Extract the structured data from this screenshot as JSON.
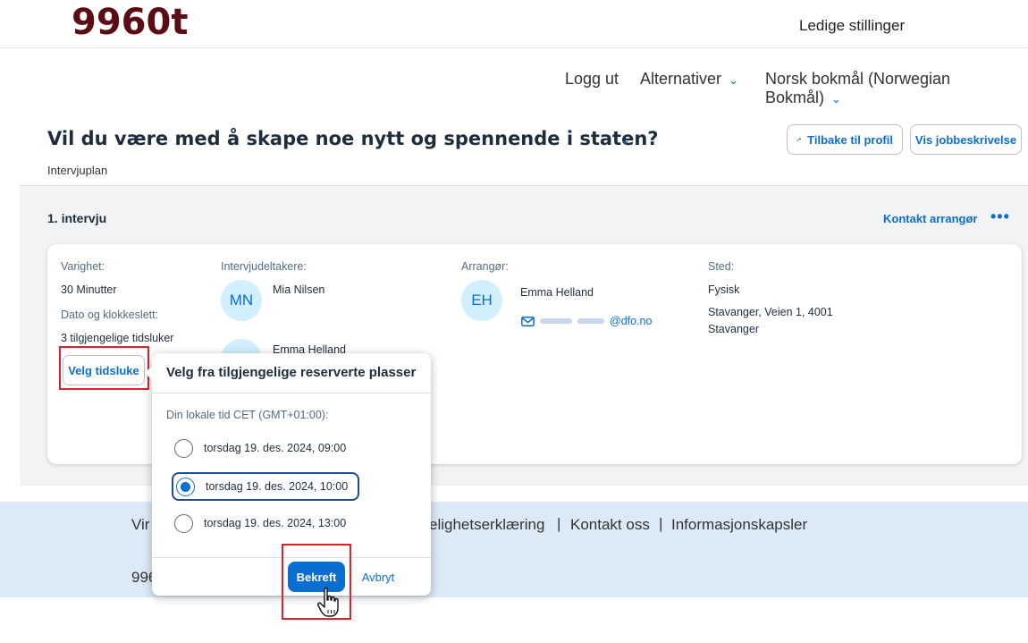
{
  "header": {
    "logo": "9960t",
    "top_link": "Ledige stillinger"
  },
  "nav": {
    "logout": "Logg ut",
    "options": "Alternativer",
    "language": "Norsk bokmål (Norwegian Bokmål)"
  },
  "page": {
    "title": "Vil du være med å skape noe nytt og spennende i staten?",
    "subtitle": "Intervjuplan",
    "back_button": "Tilbake til profil",
    "job_desc_button": "Vis jobbeskrivelse"
  },
  "interview": {
    "title": "1. intervju",
    "contact_link": "Kontakt arrangør",
    "more": "•••",
    "duration_label": "Varighet:",
    "duration_value": "30 Minutter",
    "datetime_label": "Dato og klokkeslett:",
    "slots_value": "3 tilgjengelige tidsluker",
    "choose_button": "Velg tidsluke",
    "participants_label": "Intervjudeltakere:",
    "participants": [
      {
        "initials": "MN",
        "name": "Mia Nilsen"
      },
      {
        "initials": "EH",
        "name": "Emma Helland"
      }
    ],
    "organizer_label": "Arrangør:",
    "organizer_initials": "EH",
    "organizer_name": "Emma Helland",
    "organizer_email_domain": "@dfo.no",
    "location_label": "Sted:",
    "location_type": "Fysisk",
    "location_address_1": "Stavanger, Veien 1, 4001",
    "location_address_2": "Stavanger"
  },
  "popover": {
    "title": "Velg fra tilgjengelige reserverte plasser",
    "timezone": "Din lokale tid CET (GMT+01:00):",
    "options": [
      {
        "label": "torsdag 19. des. 2024, 09:00",
        "selected": false
      },
      {
        "label": "torsdag 19. des. 2024, 10:00",
        "selected": true
      },
      {
        "label": "torsdag 19. des. 2024, 13:00",
        "selected": false
      }
    ],
    "confirm": "Bekreft",
    "cancel": "Avbryt"
  },
  "footer": {
    "link_partial_left": "Vir",
    "links_right": "elighetserklæring",
    "sep": "|",
    "contact": "Kontakt oss",
    "cookies": "Informasjonskapsler",
    "brand_partial": "996"
  },
  "colors": {
    "brand": "#5a0d14",
    "accent": "#0a6ed1",
    "highlight": "#e0202a",
    "footer_bg": "#dce9f7"
  }
}
